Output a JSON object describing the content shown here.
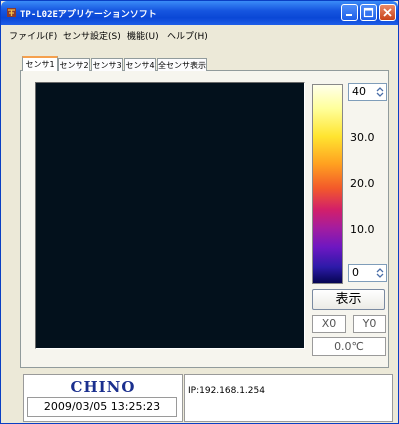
{
  "window": {
    "title": "TP-L02Eアプリケーションソフト"
  },
  "menu": [
    "ファイル(F)",
    "センサ設定(S)",
    "機能(U)",
    "ヘルプ(H)"
  ],
  "tabs": [
    "センサ1",
    "センサ2",
    "センサ3",
    "センサ4",
    "全センサ表示"
  ],
  "colors": {
    "titlebar": "#0a47d6",
    "window_bg": "#ece9d8",
    "image_bg": "#03111c",
    "logo": "#1a2f8e",
    "tab_accent": "#f5a04d"
  },
  "scale": {
    "max_value": "40",
    "min_value": "0",
    "labels": [
      "30.0",
      "20.0",
      "10.0"
    ]
  },
  "controls": {
    "display_button": "表示",
    "x_value": "X0",
    "y_value": "Y0",
    "temperature": "0.0℃"
  },
  "footer": {
    "logo": "CHINO",
    "datetime": "2009/03/05 13:25:23",
    "ip": "IP:192.168.1.254"
  },
  "icons": [
    "app-icon",
    "minimize-icon",
    "maximize-icon",
    "close-icon",
    "spin-arrows-icon"
  ]
}
